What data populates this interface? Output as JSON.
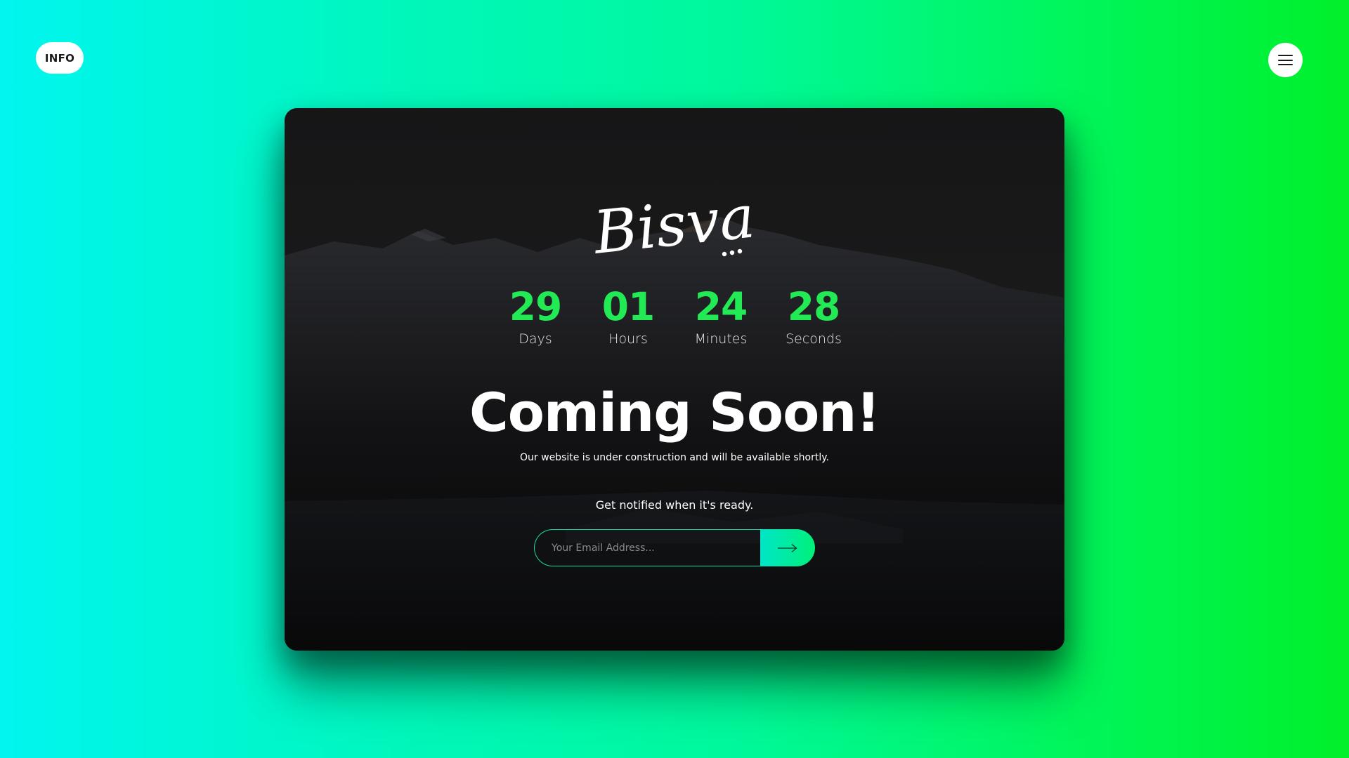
{
  "header": {
    "info_label": "INFO",
    "menu_icon": "hamburger-menu-icon"
  },
  "brand": {
    "logo_text": "Bisva",
    "accent_color": "#22ea55"
  },
  "countdown": [
    {
      "value": "29",
      "label": "Days"
    },
    {
      "value": "01",
      "label": "Hours"
    },
    {
      "value": "24",
      "label": "Minutes"
    },
    {
      "value": "28",
      "label": "Seconds"
    }
  ],
  "hero": {
    "title": "Coming Soon!",
    "subtitle": "Our website is under construction and will be available shortly."
  },
  "subscribe": {
    "prompt": "Get notified when it's ready.",
    "email_placeholder": "Your Email Address...",
    "submit_icon": "arrow-right-icon"
  }
}
